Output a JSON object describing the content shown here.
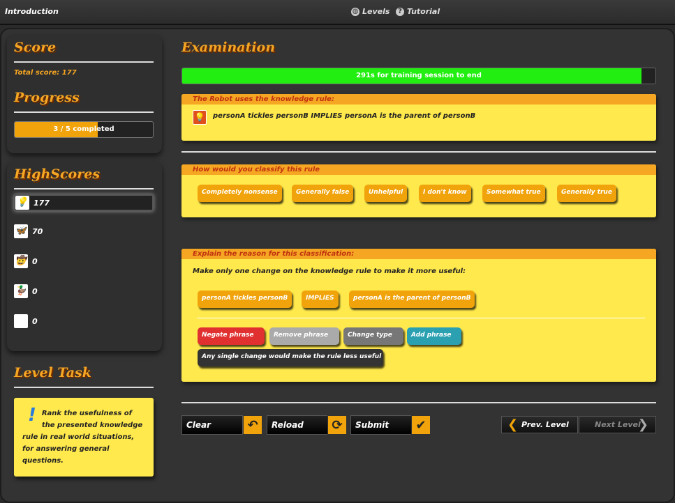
{
  "topbar": {
    "title": "Introduction",
    "levels_label": "Levels",
    "tutorial_label": "Tutorial"
  },
  "sidebar": {
    "score_heading": "Score",
    "total_score_text": "Total score: 177",
    "progress_heading": "Progress",
    "progress_text": "3 / 5 completed",
    "progress_fraction": 0.6,
    "highscores_heading": "HighScores",
    "highscores": [
      {
        "icon": "lightbulb-icon",
        "glyph": "💡",
        "score": "177"
      },
      {
        "icon": "butterfly-icon",
        "glyph": "🦋",
        "score": "70"
      },
      {
        "icon": "cowboy-icon",
        "glyph": "🤠",
        "score": "0"
      },
      {
        "icon": "duck-icon",
        "glyph": "🦆",
        "score": "0"
      },
      {
        "icon": "monkey-icon",
        "glyph": "🐵",
        "score": "0"
      }
    ],
    "level_task_heading": "Level Task",
    "level_task_text": "Rank the usefulness of the presented knowledge rule in real world situations, for answering general questions."
  },
  "main": {
    "heading": "Examination",
    "timer_text": "291s for training session to end",
    "timer_fraction": 0.97,
    "rule_box": {
      "header": "The Robot uses the knowledge rule:",
      "rule_text": "personA tickles personB IMPLIES personA is the parent of personB"
    },
    "classify_box": {
      "header": "How would you classify this rule",
      "options": [
        "Completely nonsense",
        "Generally false",
        "Unhelpful",
        "I don't know",
        "Somewhat true",
        "Generally true"
      ]
    },
    "explain_box": {
      "header": "Explain the reason for this classification:",
      "instruction": "Make only one change on the knowledge rule to make it more useful:",
      "phrases": [
        "personA tickles personB",
        "IMPLIES",
        "personA is the parent of personB"
      ],
      "actions": [
        "Negate phrase",
        "Remove phrase",
        "Change type",
        "Add phrase"
      ],
      "no_change": "Any single change would make the rule less useful"
    },
    "controls": {
      "clear": "Clear",
      "reload": "Reload",
      "submit": "Submit",
      "prev_level": "Prev. Level",
      "next_level": "Next Level"
    }
  }
}
